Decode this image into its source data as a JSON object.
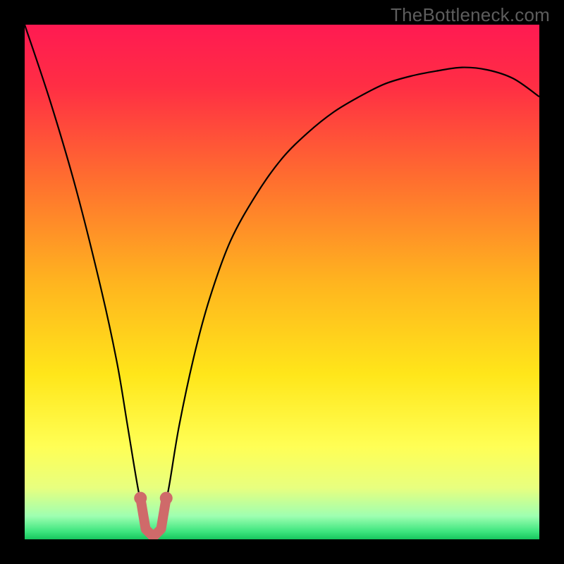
{
  "watermark": "TheBottleneck.com",
  "chart_data": {
    "type": "line",
    "title": "",
    "xlabel": "",
    "ylabel": "",
    "xlim": [
      0,
      100
    ],
    "ylim": [
      0,
      100
    ],
    "background_gradient": {
      "stops": [
        {
          "pos": 0.0,
          "color": "#ff1a52"
        },
        {
          "pos": 0.12,
          "color": "#ff2e44"
        },
        {
          "pos": 0.3,
          "color": "#ff6e2f"
        },
        {
          "pos": 0.5,
          "color": "#ffb41f"
        },
        {
          "pos": 0.68,
          "color": "#ffe61a"
        },
        {
          "pos": 0.82,
          "color": "#ffff55"
        },
        {
          "pos": 0.9,
          "color": "#e8ff7f"
        },
        {
          "pos": 0.955,
          "color": "#9effb1"
        },
        {
          "pos": 0.985,
          "color": "#3de57e"
        },
        {
          "pos": 1.0,
          "color": "#17c65e"
        }
      ]
    },
    "series": [
      {
        "name": "bottleneck-curve",
        "color": "#000000",
        "x": [
          0,
          5,
          10,
          15,
          18,
          20,
          22,
          23.5,
          25,
          26.5,
          28,
          30,
          33,
          36,
          40,
          45,
          50,
          55,
          60,
          65,
          70,
          75,
          80,
          85,
          90,
          95,
          100
        ],
        "y": [
          100,
          85,
          68,
          48,
          34,
          22,
          10,
          3,
          0,
          3,
          10,
          22,
          36,
          47,
          58,
          67,
          74,
          79,
          83,
          86,
          88.5,
          90,
          91,
          91.7,
          91.2,
          89.5,
          86
        ]
      },
      {
        "name": "highlight-u",
        "color": "#cf6a6a",
        "type": "marker-path",
        "points": [
          {
            "x": 22.5,
            "y": 8
          },
          {
            "x": 23.5,
            "y": 2
          },
          {
            "x": 25.0,
            "y": 0.5
          },
          {
            "x": 26.5,
            "y": 2
          },
          {
            "x": 27.5,
            "y": 8
          }
        ]
      }
    ]
  }
}
